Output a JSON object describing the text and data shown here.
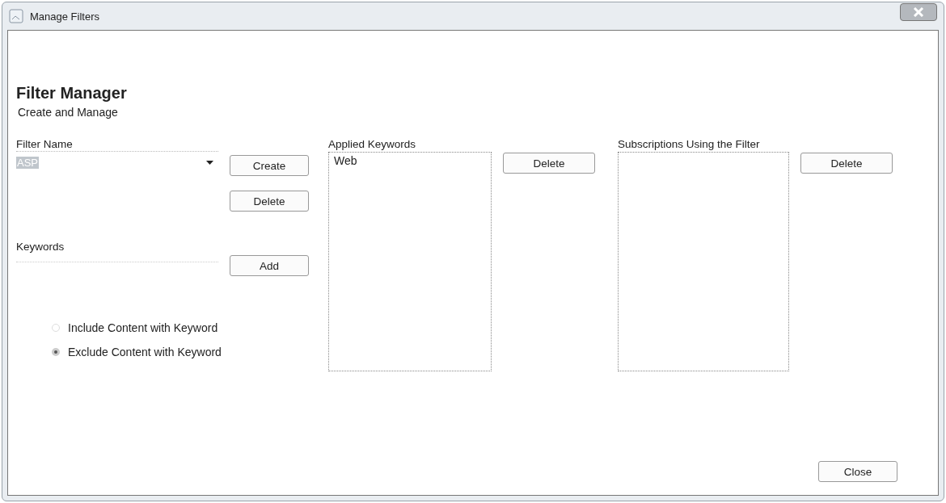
{
  "window": {
    "title": "Manage Filters"
  },
  "header": {
    "title": "Filter Manager",
    "subtitle": "Create and Manage"
  },
  "filter_name": {
    "label": "Filter Name",
    "value": "ASP"
  },
  "filter_buttons": [
    "Create",
    "Delete"
  ],
  "keywords": {
    "label": "Keywords",
    "button": "Add"
  },
  "options": [
    {
      "label": "Include Content with Keyword",
      "selected": false
    },
    {
      "label": "Exclude Content with Keyword",
      "selected": true
    }
  ],
  "applied_keywords": {
    "label": "Applied Keywords",
    "items": [
      "Web"
    ],
    "button": "Delete"
  },
  "subscriptions": {
    "label": "Subscriptions Using the Filter",
    "button": "Delete"
  },
  "close_button": "Close"
}
